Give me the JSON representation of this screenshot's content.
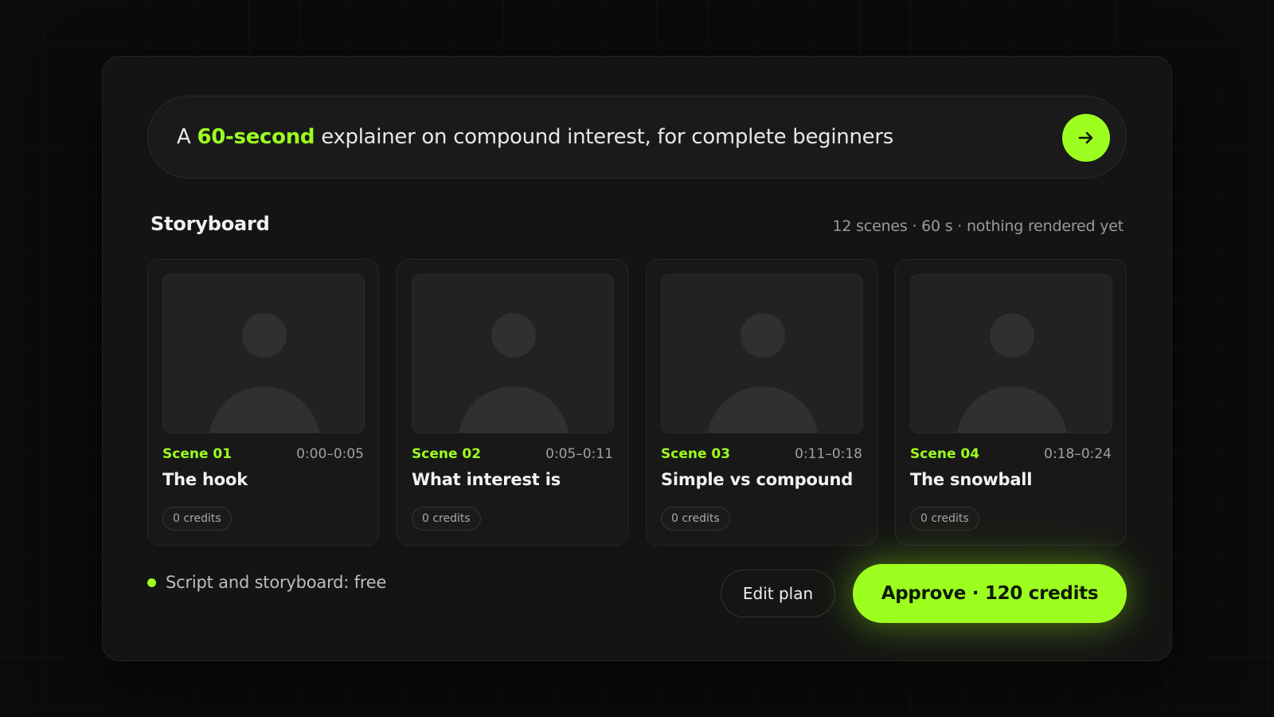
{
  "prompt": {
    "prefix": "A ",
    "highlight": "60-second",
    "suffix": " explainer on compound interest, for complete beginners",
    "submit_icon": "arrow-right-icon"
  },
  "storyboard": {
    "title": "Storyboard",
    "meta": "12 scenes · 60 s · nothing rendered yet",
    "scenes": [
      {
        "number": "Scene 01",
        "time": "0:00–0:05",
        "title": "The hook",
        "credits": "0 credits",
        "thumbnail_icon": "person-placeholder-icon"
      },
      {
        "number": "Scene 02",
        "time": "0:05–0:11",
        "title": "What interest is",
        "credits": "0 credits",
        "thumbnail_icon": "person-placeholder-icon"
      },
      {
        "number": "Scene 03",
        "time": "0:11–0:18",
        "title": "Simple vs compound",
        "credits": "0 credits",
        "thumbnail_icon": "person-placeholder-icon"
      },
      {
        "number": "Scene 04",
        "time": "0:18–0:24",
        "title": "The snowball",
        "credits": "0 credits",
        "thumbnail_icon": "person-placeholder-icon"
      }
    ]
  },
  "footer": {
    "status": "Script and storyboard: free",
    "edit_label": "Edit plan",
    "approve_label": "Approve · 120 credits"
  },
  "colors": {
    "accent": "#9dff1f",
    "background": "#0b0b0b",
    "panel": "#141414"
  }
}
